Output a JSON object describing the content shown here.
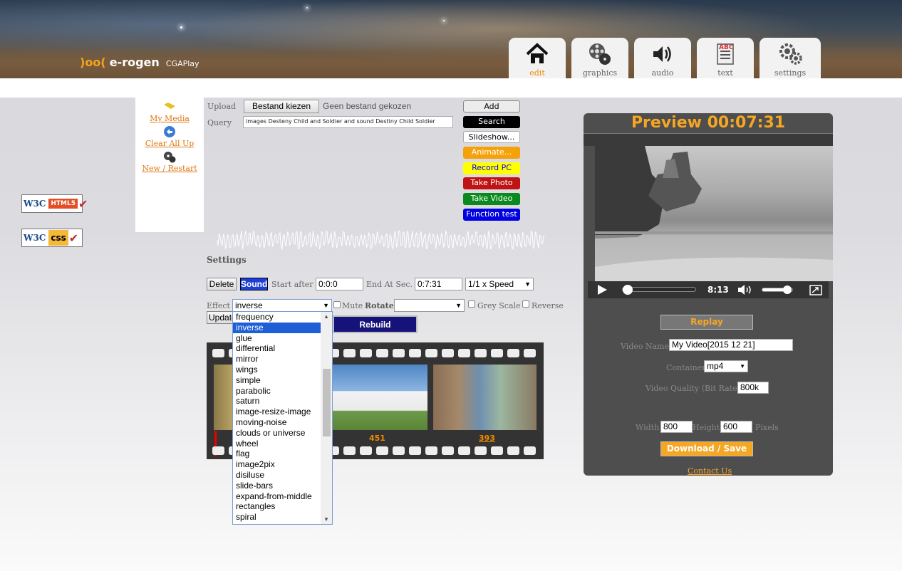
{
  "app": {
    "logo_mark": ")oo(",
    "logo_name": "e-rogen",
    "logo_sub": "CGAPlay"
  },
  "tabs": [
    {
      "label": "edit",
      "icon": "home-icon",
      "active": true
    },
    {
      "label": "graphics",
      "icon": "film-reel-icon",
      "active": false
    },
    {
      "label": "audio",
      "icon": "speaker-icon",
      "active": false
    },
    {
      "label": "text",
      "icon": "text-document-icon",
      "active": false
    },
    {
      "label": "settings",
      "icon": "gears-icon",
      "active": false
    }
  ],
  "badges": {
    "html": {
      "w3": "W3C",
      "tag": "HTML5"
    },
    "css": {
      "w3": "W3C",
      "tag": "css"
    }
  },
  "media_panel": {
    "my_media": "My Media",
    "clear_all": "Clear All Up",
    "new_restart": "New / Restart"
  },
  "upload": {
    "upload_label": "Upload",
    "file_button": "Bestand kiezen",
    "file_status": "Geen bestand gekozen",
    "query_label": "Query",
    "query_value": "images Desteny Child and Soldier and sound Destiny Child Soldier"
  },
  "actions": [
    {
      "label": "Add",
      "bg": "#ececec",
      "fg": "#000000"
    },
    {
      "label": "Search",
      "bg": "#000000",
      "fg": "#ffffff"
    },
    {
      "label": "Slideshow...",
      "bg": "#ffffff",
      "fg": "#000000"
    },
    {
      "label": "Animate...",
      "bg": "#f5a20a",
      "fg": "#ffffff"
    },
    {
      "label": "Record PC",
      "bg": "#ffff00",
      "fg": "#0000ff"
    },
    {
      "label": "Take Photo",
      "bg": "#c01313",
      "fg": "#ffffff"
    },
    {
      "label": "Take Video",
      "bg": "#0a8a1e",
      "fg": "#ffffff"
    },
    {
      "label": "Function test",
      "bg": "#0000e0",
      "fg": "#ffffff"
    }
  ],
  "settings": {
    "title": "Settings",
    "delete": "Delete",
    "sound": "Sound",
    "start_after_label": "Start after",
    "start_after": "0:0:0",
    "end_at_label": "End At Sec.",
    "end_at": "0:7:31",
    "speed": "1/1 x Speed",
    "effect_label": "Effect",
    "effect_value": "inverse",
    "mute_label": "Mute",
    "rotate_label": "Rotate",
    "rotate_value": "",
    "grey_label": "Grey Scale",
    "reverse_label": "Reverse",
    "update": "Update",
    "rebuild": "Rebuild"
  },
  "effect_options": [
    "frequency",
    "inverse",
    "glue",
    "differential",
    "mirror",
    "wings",
    "simple",
    "parabolic",
    "saturn",
    "image-resize-image",
    "moving-noise",
    "clouds or universe",
    "wheel",
    "flag",
    "image2pix",
    "disiluse",
    "slide-bars",
    "expand-from-middle",
    "rectangles",
    "spiral"
  ],
  "effect_selected": "inverse",
  "film": {
    "labels": [
      "451",
      "393"
    ]
  },
  "preview": {
    "title": "Preview 00:07:31",
    "duration": "8:13",
    "progress": 0.04,
    "volume": 0.8,
    "replay": "Replay",
    "video_name_label": "Video Name",
    "video_name": "My Video[2015 12 21]",
    "container_label": "Container",
    "container": "mp4",
    "quality_label": "Video Quality (Bit Rate)",
    "quality": "800k",
    "width_label": "Width",
    "width": "800",
    "height_label": "Height",
    "height": "600",
    "pixels_label": "Pixels",
    "download": "Download / Save",
    "contact": "Contact Us"
  }
}
